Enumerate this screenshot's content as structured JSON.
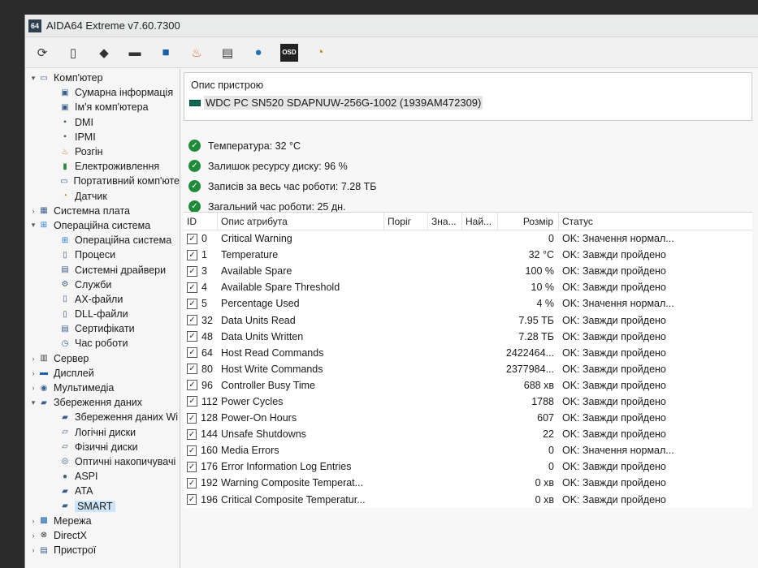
{
  "app": {
    "title": "AIDA64 Extreme v7.60.7300",
    "logo": "64"
  },
  "toolbar": {
    "buttons": [
      "refresh-icon",
      "report-icon",
      "disk-icon",
      "memory-icon",
      "network-icon",
      "flame-icon",
      "bios-icon",
      "user-icon",
      "osd-icon",
      "gauge-icon"
    ]
  },
  "tree": {
    "items": [
      {
        "label": "Комп'ютер",
        "level": 0,
        "arrow": "▾",
        "icon": "computer-icon"
      },
      {
        "label": "Сумарна інформація",
        "level": 2,
        "arrow": "",
        "icon": "summary-icon"
      },
      {
        "label": "Ім'я комп'ютера",
        "level": 2,
        "arrow": "",
        "icon": "computer-name-icon"
      },
      {
        "label": "DMI",
        "level": 2,
        "arrow": "",
        "icon": "dmi-icon"
      },
      {
        "label": "IPMI",
        "level": 2,
        "arrow": "",
        "icon": "ipmi-icon"
      },
      {
        "label": "Розгін",
        "level": 2,
        "arrow": "",
        "icon": "overclock-icon"
      },
      {
        "label": "Електроживлення",
        "level": 2,
        "arrow": "",
        "icon": "power-icon"
      },
      {
        "label": "Портативний комп'юте",
        "level": 2,
        "arrow": "",
        "icon": "laptop-icon"
      },
      {
        "label": "Датчик",
        "level": 2,
        "arrow": "",
        "icon": "sensor-icon"
      },
      {
        "label": "Системна плата",
        "level": 0,
        "arrow": "›",
        "icon": "motherboard-icon"
      },
      {
        "label": "Операційна система",
        "level": 0,
        "arrow": "▾",
        "icon": "windows-icon"
      },
      {
        "label": "Операційна система",
        "level": 2,
        "arrow": "",
        "icon": "windows-icon"
      },
      {
        "label": "Процеси",
        "level": 2,
        "arrow": "",
        "icon": "process-icon"
      },
      {
        "label": "Системні драйвери",
        "level": 2,
        "arrow": "",
        "icon": "driver-icon"
      },
      {
        "label": "Служби",
        "level": 2,
        "arrow": "",
        "icon": "services-icon"
      },
      {
        "label": "AX-файли",
        "level": 2,
        "arrow": "",
        "icon": "file-icon"
      },
      {
        "label": "DLL-файли",
        "level": 2,
        "arrow": "",
        "icon": "file-icon"
      },
      {
        "label": "Сертифікати",
        "level": 2,
        "arrow": "",
        "icon": "certificate-icon"
      },
      {
        "label": "Час роботи",
        "level": 2,
        "arrow": "",
        "icon": "uptime-icon"
      },
      {
        "label": "Сервер",
        "level": 0,
        "arrow": "›",
        "icon": "server-icon"
      },
      {
        "label": "Дисплей",
        "level": 0,
        "arrow": "›",
        "icon": "display-icon"
      },
      {
        "label": "Мультимедіа",
        "level": 0,
        "arrow": "›",
        "icon": "multimedia-icon"
      },
      {
        "label": "Збереження даних",
        "level": 0,
        "arrow": "▾",
        "icon": "storage-icon"
      },
      {
        "label": "Збереження даних Wi",
        "level": 2,
        "arrow": "",
        "icon": "storage-icon"
      },
      {
        "label": "Логічні диски",
        "level": 2,
        "arrow": "",
        "icon": "logical-disk-icon"
      },
      {
        "label": "Фізичні диски",
        "level": 2,
        "arrow": "",
        "icon": "physical-disk-icon"
      },
      {
        "label": "Оптичні накопичувачі",
        "level": 2,
        "arrow": "",
        "icon": "optical-drive-icon"
      },
      {
        "label": "ASPI",
        "level": 2,
        "arrow": "",
        "icon": "aspi-icon"
      },
      {
        "label": "ATA",
        "level": 2,
        "arrow": "",
        "icon": "ata-icon"
      },
      {
        "label": "SMART",
        "level": 2,
        "arrow": "",
        "icon": "smart-icon",
        "selected": true
      },
      {
        "label": "Мережа",
        "level": 0,
        "arrow": "›",
        "icon": "network-icon"
      },
      {
        "label": "DirectX",
        "level": 0,
        "arrow": "›",
        "icon": "directx-icon"
      },
      {
        "label": "Пристрої",
        "level": 0,
        "arrow": "›",
        "icon": "devices-icon"
      }
    ]
  },
  "device": {
    "header": "Опис пристрою",
    "name": "WDC PC SN520 SDAPNUW-256G-1002 (1939AM472309)"
  },
  "summary": [
    "Температура: 32 °C",
    "Залишок ресурсу диску: 96 %",
    "Записів за весь час роботи: 7.28 ТБ",
    "Загальний час роботи: 25 дн."
  ],
  "table": {
    "headers": {
      "id": "ID",
      "name": "Опис атрибута",
      "threshold": "Поріг",
      "value": "Зна...",
      "worst": "Най...",
      "size": "Розмір",
      "status": "Статус"
    },
    "rows": [
      {
        "id": "0",
        "name": "Critical Warning",
        "size": "0",
        "status": "OK: Значення нормал..."
      },
      {
        "id": "1",
        "name": "Temperature",
        "size": "32 °C",
        "status": "OK: Завжди пройдено"
      },
      {
        "id": "3",
        "name": "Available Spare",
        "size": "100 %",
        "status": "OK: Завжди пройдено"
      },
      {
        "id": "4",
        "name": "Available Spare Threshold",
        "size": "10 %",
        "status": "OK: Завжди пройдено"
      },
      {
        "id": "5",
        "name": "Percentage Used",
        "size": "4 %",
        "status": "OK: Значення нормал..."
      },
      {
        "id": "32",
        "name": "Data Units Read",
        "size": "7.95 ТБ",
        "status": "OK: Завжди пройдено"
      },
      {
        "id": "48",
        "name": "Data Units Written",
        "size": "7.28 ТБ",
        "status": "OK: Завжди пройдено"
      },
      {
        "id": "64",
        "name": "Host Read Commands",
        "size": "2422464...",
        "status": "OK: Завжди пройдено"
      },
      {
        "id": "80",
        "name": "Host Write Commands",
        "size": "2377984...",
        "status": "OK: Завжди пройдено"
      },
      {
        "id": "96",
        "name": "Controller Busy Time",
        "size": "688 хв",
        "status": "OK: Завжди пройдено"
      },
      {
        "id": "112",
        "name": "Power Cycles",
        "size": "1788",
        "status": "OK: Завжди пройдено"
      },
      {
        "id": "128",
        "name": "Power-On Hours",
        "size": "607",
        "status": "OK: Завжди пройдено"
      },
      {
        "id": "144",
        "name": "Unsafe Shutdowns",
        "size": "22",
        "status": "OK: Завжди пройдено"
      },
      {
        "id": "160",
        "name": "Media Errors",
        "size": "0",
        "status": "OK: Значення нормал..."
      },
      {
        "id": "176",
        "name": "Error Information Log Entries",
        "size": "0",
        "status": "OK: Завжди пройдено"
      },
      {
        "id": "192",
        "name": "Warning Composite Temperat...",
        "size": "0 хв",
        "status": "OK: Завжди пройдено"
      },
      {
        "id": "196",
        "name": "Critical Composite Temperatur...",
        "size": "0 хв",
        "status": "OK: Завжди пройдено"
      }
    ]
  },
  "colors": {
    "ok_green": "#1f8a3a",
    "selection": "#cce4f7",
    "disk_icon": "#0d6b5a"
  }
}
